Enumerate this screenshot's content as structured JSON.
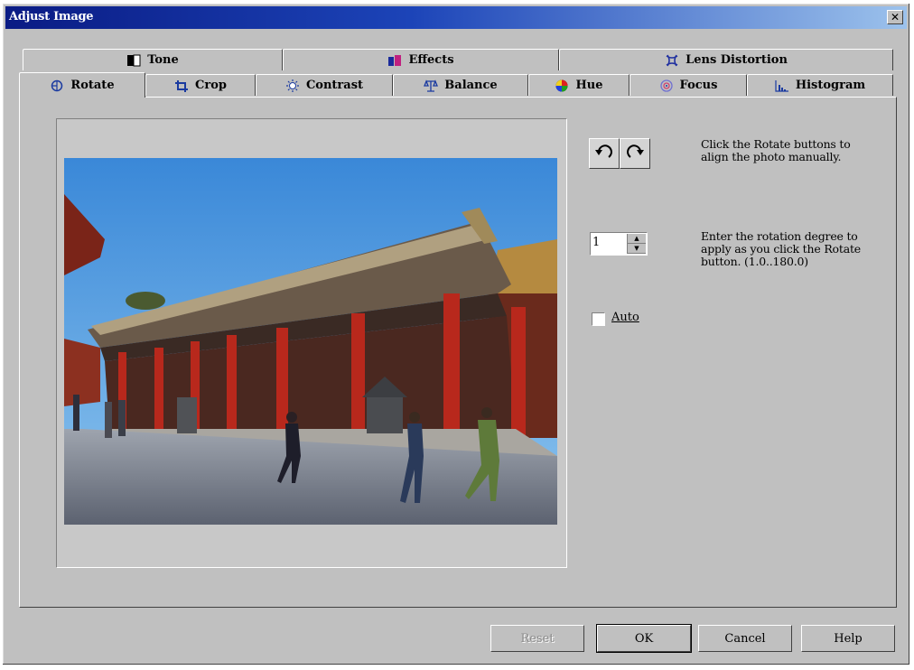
{
  "window": {
    "title": "Adjust Image",
    "close_glyph": "✕"
  },
  "tabs_row1": [
    {
      "label": "Tone",
      "icon": "tone-icon"
    },
    {
      "label": "Effects",
      "icon": "effects-icon"
    },
    {
      "label": "Lens Distortion",
      "icon": "lens-distortion-icon"
    }
  ],
  "tabs_row2": [
    {
      "label": "Rotate",
      "icon": "rotate-icon",
      "active": true
    },
    {
      "label": "Crop",
      "icon": "crop-icon"
    },
    {
      "label": "Contrast",
      "icon": "contrast-icon"
    },
    {
      "label": "Balance",
      "icon": "balance-icon"
    },
    {
      "label": "Hue",
      "icon": "hue-icon"
    },
    {
      "label": "Focus",
      "icon": "focus-icon"
    },
    {
      "label": "Histogram",
      "icon": "histogram-icon"
    }
  ],
  "rotate": {
    "help_buttons": "Click the Rotate buttons to align the photo manually.",
    "help_degree": "Enter the rotation degree to apply as you click the Rotate button. (1.0..180.0)",
    "degree_value": "1",
    "auto_label": "Auto",
    "auto_checked": false
  },
  "buttons": {
    "reset": "Reset",
    "ok": "OK",
    "cancel": "Cancel",
    "help": "Help"
  },
  "colors": {
    "title_start": "#0a1b84",
    "title_end": "#9cc2ec",
    "face": "#c0c0c0"
  }
}
